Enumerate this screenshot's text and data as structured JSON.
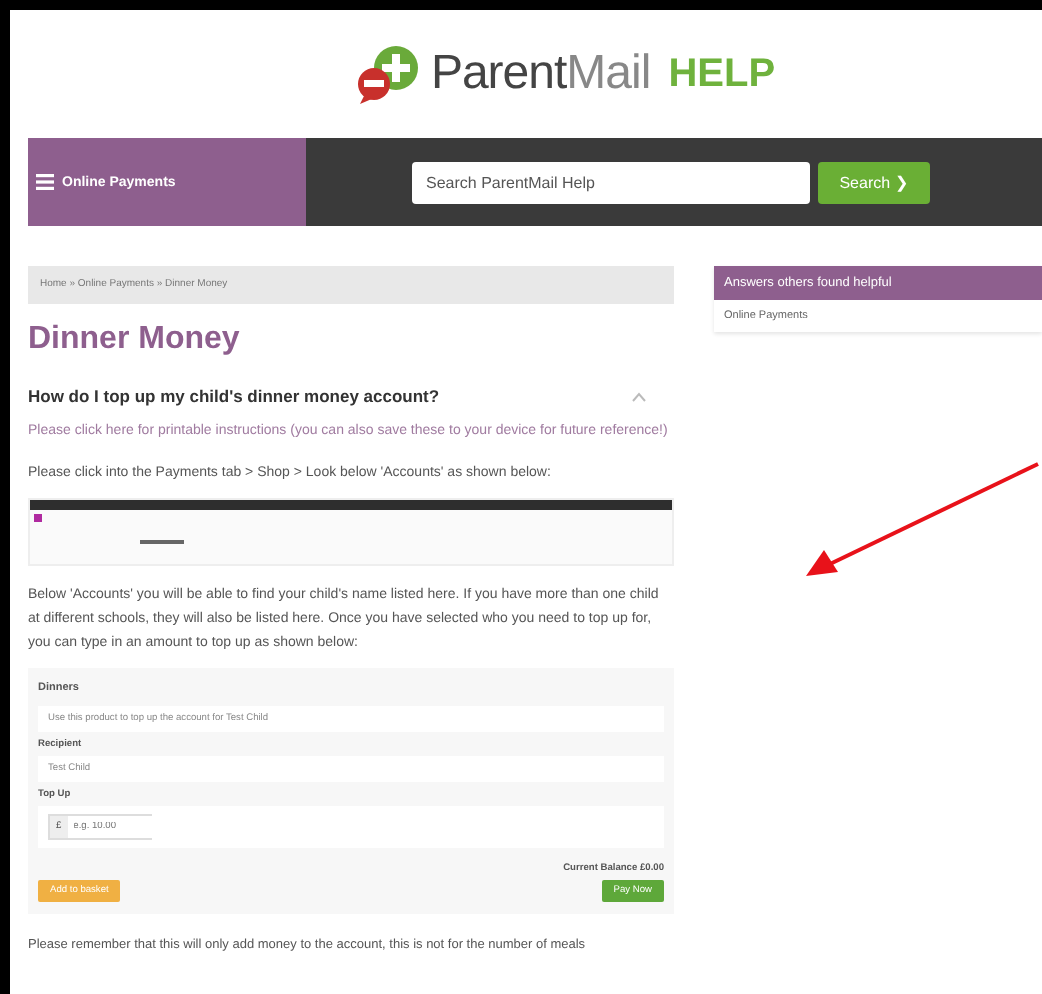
{
  "logo": {
    "word_strong": "Parent",
    "word_light": "Mail",
    "suffix": "HELP"
  },
  "nav": {
    "menu_label": "Online Payments",
    "search_placeholder": "Search ParentMail Help",
    "search_button": "Search ❯"
  },
  "breadcrumb": "Home » Online Payments » Dinner Money",
  "sidebar": {
    "title": "Answers others found helpful",
    "items": [
      "Online Payments"
    ]
  },
  "article": {
    "title": "Dinner Money",
    "question": "How do I top up my child's dinner money account?",
    "expanded": true,
    "link": "Please click here for printable instructions (you can also save these to your device for future reference!)",
    "step": "Please click into the Payments tab > Shop > Look below 'Accounts' as shown below:",
    "explanation": "Below 'Accounts' you will be able to find your child's name listed here. If you have more than one child at different schools, they will also be listed here. Once you have selected who you need to top up for, you can type in an amount to top up as shown below:",
    "form": {
      "title": "Dinners",
      "description": "Use this product to top up the account for Test Child",
      "recipient_label": "Recipient",
      "recipient": "Test Child",
      "topup_label": "Top Up",
      "currency": "£",
      "amount_placeholder": "e.g. 10.00",
      "balance": "Current Balance £0.00",
      "basket_button": "Add to basket",
      "pay_button": "Pay Now"
    },
    "note": "Please remember that this will only add money to the account, this is not for the number of meals"
  }
}
